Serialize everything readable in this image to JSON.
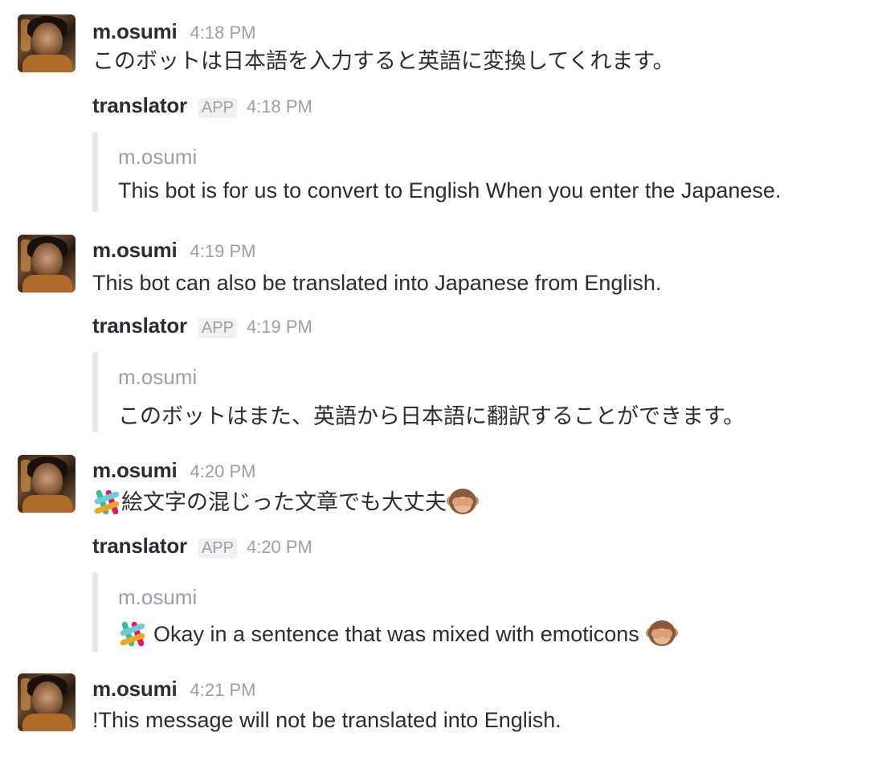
{
  "messages": [
    {
      "author": "m.osumi",
      "time": "4:18 PM",
      "text": "このボットは日本語を入力すると英語に変換してくれます。"
    },
    {
      "author": "translator",
      "badge": "APP",
      "time": "4:18 PM",
      "attachment": {
        "author": "m.osumi",
        "text": "This bot is for us to convert to English When you enter the Japanese."
      }
    },
    {
      "author": "m.osumi",
      "time": "4:19 PM",
      "text": "This bot can also be translated into Japanese from English."
    },
    {
      "author": "translator",
      "badge": "APP",
      "time": "4:19 PM",
      "attachment": {
        "author": "m.osumi",
        "text": "このボットはまた、英語から日本語に翻訳することができます。"
      }
    },
    {
      "author": "m.osumi",
      "time": "4:20 PM",
      "text": "絵文字の混じった文章でも大丈夫",
      "leading_icon": "slack-logo-icon",
      "trailing_icon": "see-no-evil-monkey-icon"
    },
    {
      "author": "translator",
      "badge": "APP",
      "time": "4:20 PM",
      "attachment": {
        "author": "m.osumi",
        "text": "Okay in a sentence that was mixed with emoticons",
        "leading_icon": "slack-logo-icon",
        "trailing_icon": "see-no-evil-monkey-icon"
      }
    },
    {
      "author": "m.osumi",
      "time": "4:21 PM",
      "text": "!This message will not be translated into English."
    }
  ],
  "colors": {
    "name": "#2c2d30",
    "timestamp": "#9e9ea6",
    "attachment_bar": "#e8e8e8"
  }
}
